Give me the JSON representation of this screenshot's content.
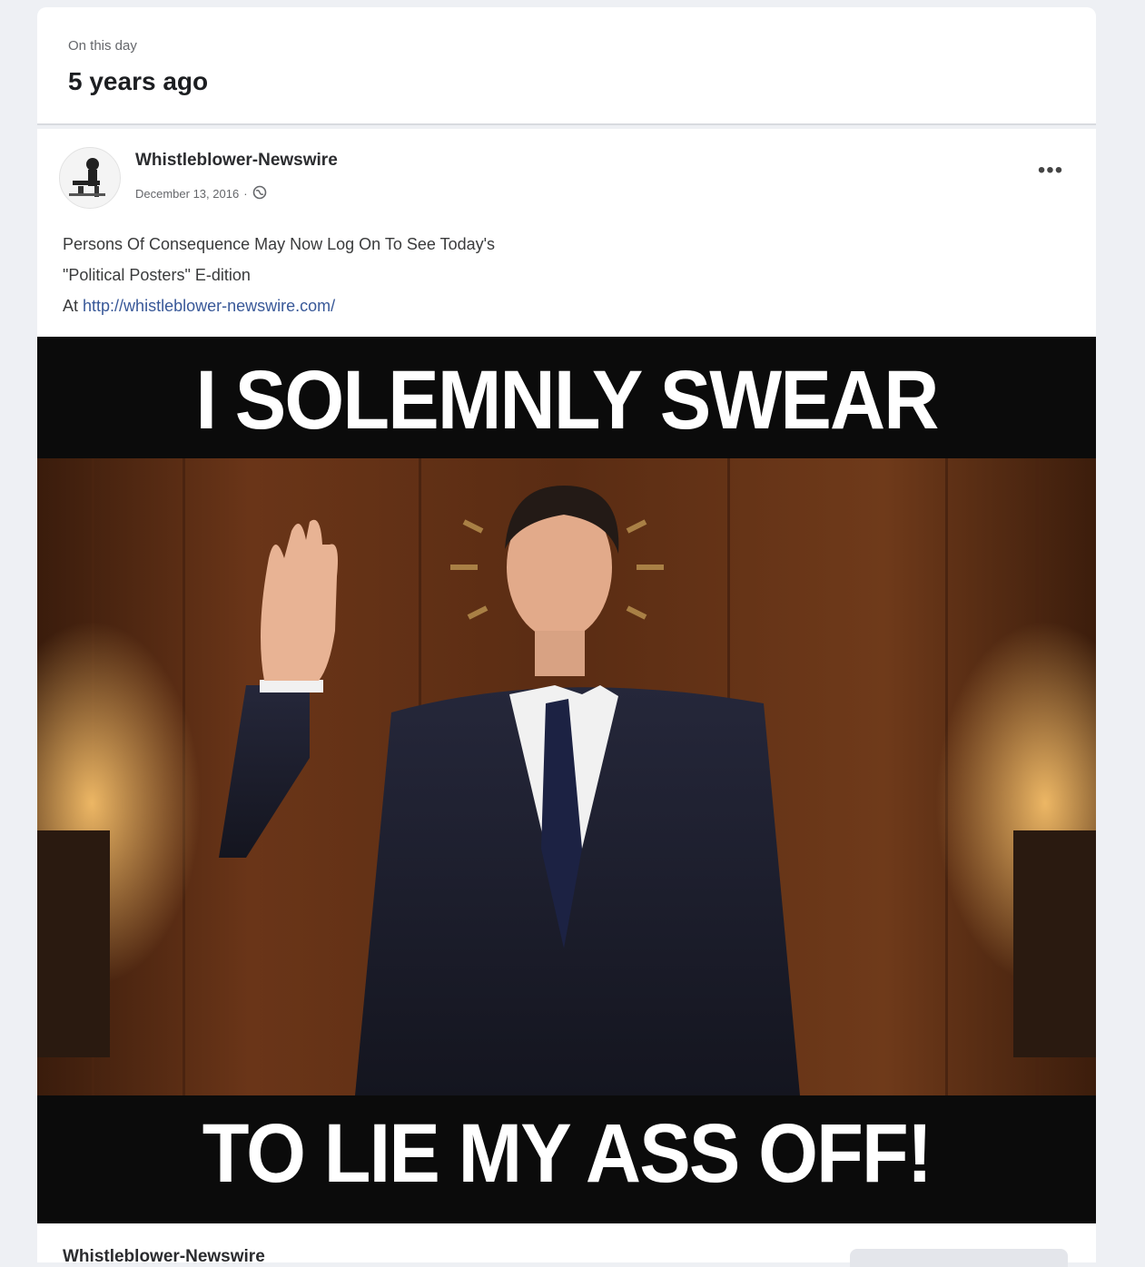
{
  "memory": {
    "label": "On this day",
    "heading": "5 years ago"
  },
  "post": {
    "author": "Whistleblower-Newswire",
    "date": "December 13, 2016",
    "separator": "·",
    "visibility_icon": "globe-icon",
    "more_label": "•••",
    "text_line1": "Persons Of Consequence May Now Log On To See Today's",
    "text_line2": "\"Political Posters\" E-dition",
    "text_line3_prefix": "At",
    "link": "http://whistleblower-newswire.com/"
  },
  "meme": {
    "top_caption": "I SOLEMNLY SWEAR",
    "bottom_caption": "TO LIE MY ASS OFF!"
  },
  "footer": {
    "author": "Whistleblower-Newswire"
  },
  "colors": {
    "page_bg": "#eef0f4",
    "card_bg": "#ffffff",
    "link": "#385898",
    "meme_bg": "#0b0b0b"
  }
}
